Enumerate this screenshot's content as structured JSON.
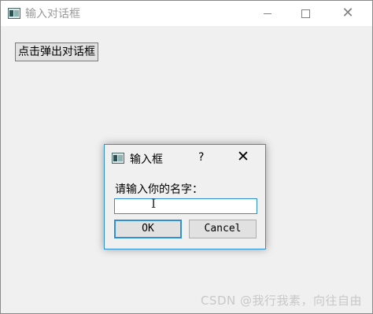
{
  "main_window": {
    "title": "输入对话框",
    "minimize_symbol": "",
    "close_symbol": "✕",
    "popup_button_label": "点击弹出对话框"
  },
  "dialog": {
    "title": "输入框",
    "help_symbol": "?",
    "close_symbol": "✕",
    "prompt": "请输入你的名字：",
    "input_value": "",
    "ok_label": "OK",
    "cancel_label": "Cancel"
  },
  "cursor_symbol": "I",
  "watermark": "CSDN @我行我素，向往自由",
  "colors": {
    "accent": "#2e90d8",
    "window_bg": "#f0f0f0",
    "button_bg": "#e1e1e1"
  },
  "icons": [
    "app-icon",
    "minimize-icon",
    "maximize-icon",
    "close-icon",
    "help-icon",
    "text-cursor-icon"
  ]
}
